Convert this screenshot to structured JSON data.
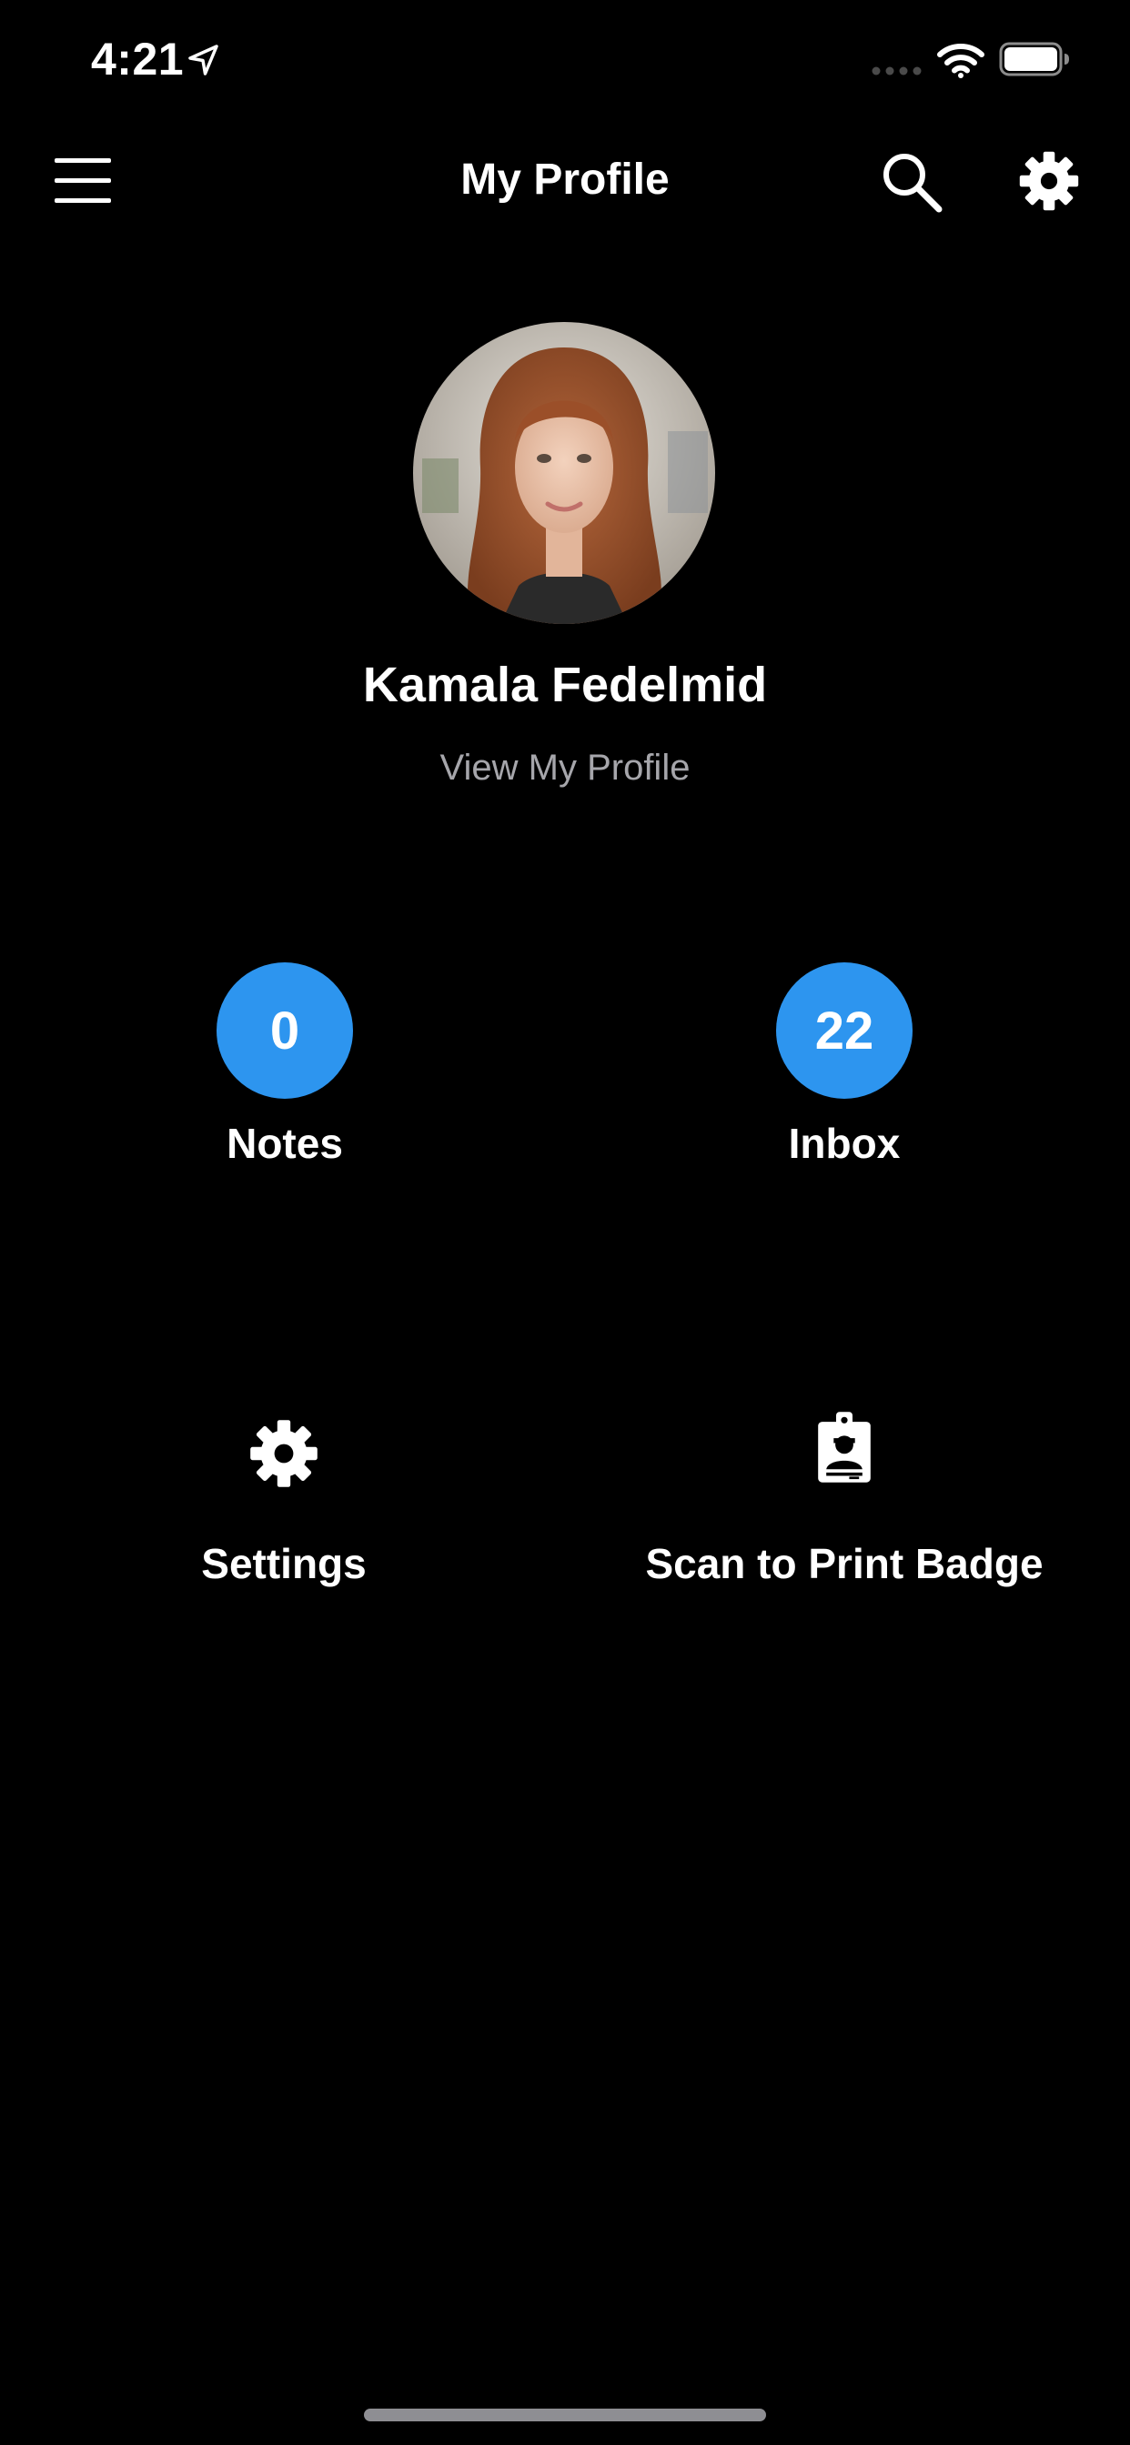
{
  "status_bar": {
    "time": "4:21",
    "icons": [
      "location-arrow-icon",
      "cellular-signal-icon",
      "wifi-icon",
      "battery-icon"
    ]
  },
  "nav": {
    "title": "My Profile",
    "left_icon": "hamburger-menu-icon",
    "right_icons": [
      "search-icon",
      "gear-icon"
    ]
  },
  "profile": {
    "name": "Kamala Fedelmid",
    "view_link": "View My Profile"
  },
  "counters": [
    {
      "label": "Notes",
      "count": "0"
    },
    {
      "label": "Inbox",
      "count": "22"
    }
  ],
  "actions": [
    {
      "label": "Settings",
      "icon": "gear-icon"
    },
    {
      "label": "Scan to Print Badge",
      "icon": "id-badge-icon"
    }
  ],
  "colors": {
    "background": "#000000",
    "text": "#ffffff",
    "secondary_text": "#a6a6ab",
    "accent": "#2d95ef",
    "home_indicator": "#8e8e93"
  }
}
